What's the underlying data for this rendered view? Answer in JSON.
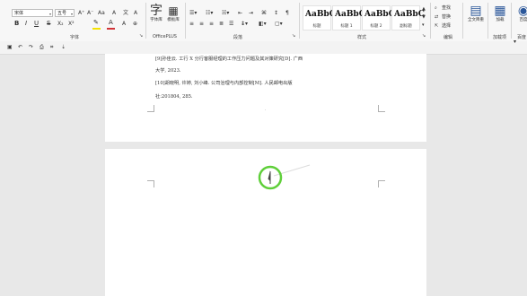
{
  "ribbon": {
    "font": {
      "font_name": "宋体",
      "font_size": "五号",
      "label": "字体",
      "grow": "A⁺",
      "shrink": "A⁻",
      "aa": "Aa",
      "clear": "A",
      "char_a": "A",
      "bold": "B",
      "italic": "I",
      "underline": "U",
      "strike": "S",
      "sub": "X₂",
      "sup": "X²",
      "font_color_a": "A",
      "wen": "文"
    },
    "officeplus": {
      "btn1": "字体库",
      "btn2": "模板库",
      "label": "OfficePLUS"
    },
    "paragraph": {
      "label": "段落"
    },
    "styles": {
      "label": "样式",
      "items": [
        {
          "sample": "AaBbC",
          "name": "标题"
        },
        {
          "sample": "AaBbC",
          "name": "标题 1"
        },
        {
          "sample": "AaBbC",
          "name": "标题 2"
        },
        {
          "sample": "AaBbC",
          "name": "副标题"
        }
      ]
    },
    "editing": {
      "find": "查找",
      "replace": "替换",
      "select": "选择",
      "label": "编辑"
    },
    "fulltext": {
      "label": "全文降重"
    },
    "addins": {
      "btn": "加载",
      "label": "加载项"
    },
    "right_cut": {
      "btn": "百度",
      "label": "百度"
    }
  },
  "document": {
    "references": [
      "[9]孙佳云. 工行 X 分行客服经理的工作压力问题及其对策研究[D]. 广西",
      "大学, 2023.",
      "[10]胡晓明, 许婷, 刘小峰. 公司治理与内部控制[M]. 人民邮电出版",
      "社:201804, 285."
    ]
  },
  "colors": {
    "accent": "#2b579a",
    "cursor_ring": "#5fcf3a",
    "font_red": "#d13438",
    "highlight_yellow": "#f5e200"
  },
  "icons": [
    "font-color-icon",
    "highlight-icon",
    "find-icon",
    "replace-icon",
    "select-icon",
    "cursor-highlight-icon"
  ]
}
